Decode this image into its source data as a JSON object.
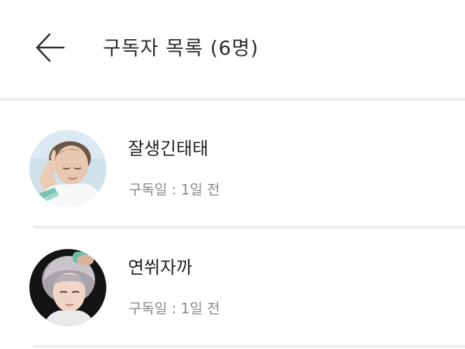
{
  "header": {
    "back_icon": "arrow-left-icon",
    "title": "구독자 목록 (6명)"
  },
  "subscribers": [
    {
      "nickname": "잘생긴태태",
      "subscribed_text": "구독일 : 1일 전",
      "avatar_icon": "user-photo"
    },
    {
      "nickname": "연쒸자까",
      "subscribed_text": "구독일 : 1일 전",
      "avatar_icon": "user-photo"
    }
  ],
  "colors": {
    "background": "#ffffff",
    "divider": "#ebebeb",
    "title_text": "#2b2b2b",
    "meta_text": "#8a8a8a"
  }
}
